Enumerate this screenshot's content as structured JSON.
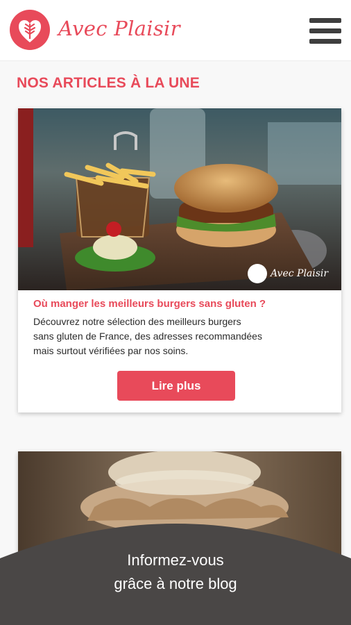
{
  "header": {
    "brand_name": "Avec Plaisir",
    "logo_icon": "wheat-heart-icon",
    "menu_icon": "hamburger-menu-icon"
  },
  "section": {
    "title": "NOS ARTICLES À LA UNE"
  },
  "articles": [
    {
      "image": "burger-fries-photo",
      "watermark": "Avec Plaisir",
      "title": "Où manger les meilleurs burgers sans gluten ?",
      "excerpt_lines": [
        "Découvrez notre sélection des meilleurs burgers",
        "sans gluten de France, des adresses recommandées",
        "mais surtout vérifiées par nos soins."
      ],
      "button_label": "Lire plus"
    },
    {
      "image": "pastry-cream-photo"
    }
  ],
  "banner": {
    "line1": "Informez-vous",
    "line2": "grâce à notre blog"
  },
  "colors": {
    "accent": "#e84a5a",
    "banner": "#4a4746"
  }
}
